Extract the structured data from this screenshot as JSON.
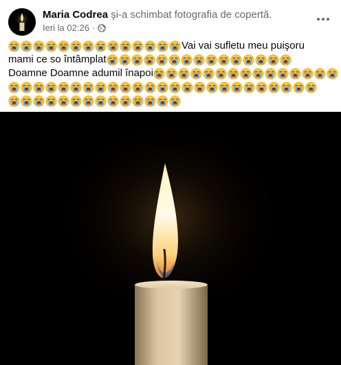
{
  "post": {
    "author": "Maria Codrea",
    "action": " şi-a schimbat fotografia de copertă.",
    "timestamp": "Ieri la 02:26",
    "separator": "·",
    "icons": {
      "privacy": "globe-icon",
      "more": "more-options-icon",
      "emoji": "loudly-crying-face-emoji"
    },
    "message_lines": [
      {
        "emoji_before": 14,
        "text": "Vai vai sufletu meu puişoru",
        "emoji_after": 0
      },
      {
        "emoji_before": 0,
        "text": "mami ce so întâmplat",
        "emoji_after": 15
      },
      {
        "emoji_before": 0,
        "text": "Doamne Doamne adumil înapoi",
        "emoji_after": 15
      },
      {
        "emoji_before": 25,
        "text": "",
        "emoji_after": 0
      },
      {
        "emoji_before": 14,
        "text": "",
        "emoji_after": 0
      }
    ],
    "photo": {
      "subject": "candle-flame-photo",
      "background_color": "#000000",
      "wax_color": "#e8d3b3",
      "flame_color": "#fff7d6"
    }
  }
}
